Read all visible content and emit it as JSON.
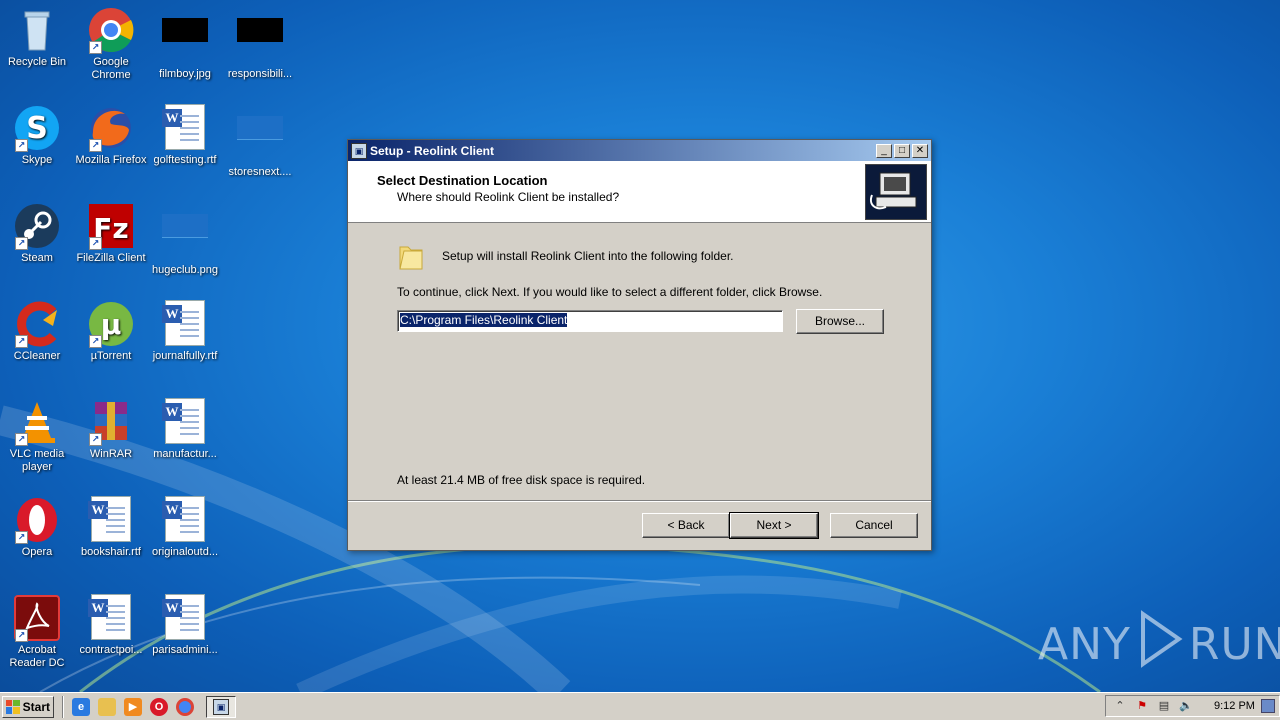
{
  "desktop": {
    "icons": [
      {
        "label": "Recycle Bin",
        "icon": "recycle-bin-icon"
      },
      {
        "label": "Google Chrome",
        "icon": "chrome-icon"
      },
      {
        "label": "filmboy.jpg",
        "icon": "image-thumb-icon"
      },
      {
        "label": "responsibili...",
        "icon": "image-thumb-icon"
      },
      {
        "label": "Skype",
        "icon": "skype-icon"
      },
      {
        "label": "Mozilla Firefox",
        "icon": "firefox-icon"
      },
      {
        "label": "golftesting.rtf",
        "icon": "word-doc-icon"
      },
      {
        "label": "storesnext....",
        "icon": "image-thumb-icon"
      },
      {
        "label": "Steam",
        "icon": "steam-icon"
      },
      {
        "label": "FileZilla Client",
        "icon": "filezilla-icon"
      },
      {
        "label": "hugeclub.png",
        "icon": "image-thumb-icon"
      },
      {
        "label": "CCleaner",
        "icon": "ccleaner-icon"
      },
      {
        "label": "µTorrent",
        "icon": "utorrent-icon"
      },
      {
        "label": "journalfully.rtf",
        "icon": "word-doc-icon"
      },
      {
        "label": "VLC media player",
        "icon": "vlc-icon"
      },
      {
        "label": "WinRAR",
        "icon": "winrar-icon"
      },
      {
        "label": "manufactur...",
        "icon": "word-doc-icon"
      },
      {
        "label": "Opera",
        "icon": "opera-icon"
      },
      {
        "label": "bookshair.rtf",
        "icon": "word-doc-icon"
      },
      {
        "label": "originaloutd...",
        "icon": "word-doc-icon"
      },
      {
        "label": "Acrobat Reader DC",
        "icon": "acrobat-icon"
      },
      {
        "label": "contractpoi...",
        "icon": "word-doc-icon"
      },
      {
        "label": "parisadmini...",
        "icon": "word-doc-icon"
      }
    ]
  },
  "dialog": {
    "title": "Setup - Reolink Client",
    "header_title": "Select Destination Location",
    "header_subtitle": "Where should Reolink Client be installed?",
    "install_text": "Setup will install Reolink Client into the following folder.",
    "continue_text": "To continue, click Next. If you would like to select a different folder, click Browse.",
    "path_value": "C:\\Program Files\\Reolink Client",
    "browse_label": "Browse...",
    "disk_text": "At least 21.4 MB of free disk space is required.",
    "back_label": "< Back",
    "next_label": "Next >",
    "cancel_label": "Cancel",
    "minimize_glyph": "_",
    "maximize_glyph": "□",
    "close_glyph": "✕"
  },
  "taskbar": {
    "start_label": "Start",
    "clock": "9:12 PM"
  },
  "watermark": {
    "left": "ANY",
    "right": "RUN"
  }
}
